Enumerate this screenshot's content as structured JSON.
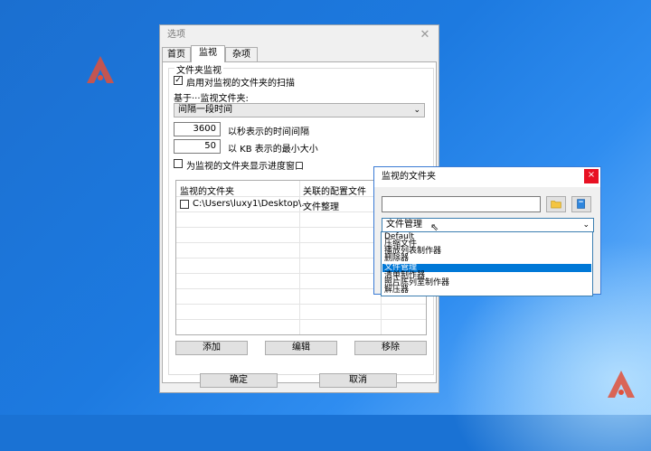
{
  "options_dialog": {
    "title": "选项",
    "tabs": [
      {
        "label": "首页"
      },
      {
        "label": "监视"
      },
      {
        "label": "杂项"
      }
    ],
    "group_title": "文件夹监视",
    "enable_scan_label": "启用对监视的文件夹的扫描",
    "enable_scan_checked": true,
    "based_on_label": "基于···监视文件夹:",
    "based_on_value": "间隔一段时间",
    "interval_value": "3600",
    "interval_label": "以秒表示的时间间隔",
    "min_size_value": "50",
    "min_size_label": "以 KB 表示的最小大小",
    "progress_label": "为监视的文件夹显示进度窗口",
    "progress_checked": false,
    "list_headers": [
      "监视的文件夹",
      "关联的配置文件"
    ],
    "list_rows": [
      {
        "folder": "C:\\Users\\luxy1\\Desktop\\...",
        "profile": "文件整理",
        "checked": false
      }
    ],
    "add_label": "添加",
    "edit_label": "编辑",
    "remove_label": "移除",
    "ok_label": "确定",
    "cancel_label": "取消"
  },
  "monitor_dialog": {
    "title": "监视的文件夹",
    "close_glyph": "×",
    "path_value": "",
    "profile_selected": "文件管理",
    "profile_options": [
      "Default",
      "压缩文件",
      "播放列表制作器",
      "删除器",
      "文件管理",
      "清单制作器",
      "照片陈列室制作器",
      "解压器"
    ],
    "selected_index": 4
  },
  "colors": {
    "accent": "#0078d7",
    "close_red": "#e81123",
    "desktop_blue": "#1d7ae0",
    "logo_red": "#e0503a"
  },
  "icons": [
    "logo-icon",
    "close-icon",
    "chevron-down-icon",
    "folder-icon",
    "book-icon",
    "check-icon",
    "cursor-icon"
  ]
}
